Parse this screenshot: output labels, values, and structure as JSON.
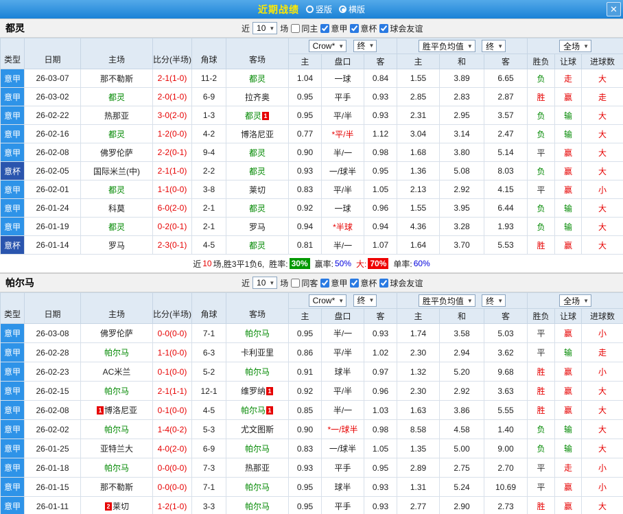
{
  "titlebar": {
    "title": "近期战绩",
    "vertical_label": "竖版",
    "horizontal_label": "横版",
    "close_label": "✕"
  },
  "colors": {
    "league_serie_a": "#2e93e8",
    "league_coppa": "#2a55ae",
    "win_red": "#e60000",
    "lose_green": "#008800",
    "title_yellow": "#ffea00",
    "titlebar_blue": "#1b82d6"
  },
  "table_header": {
    "cols": [
      "类型",
      "日期",
      "主场",
      "比分(半场)",
      "角球",
      "客场"
    ],
    "odds_cols": [
      "主",
      "盘口",
      "客"
    ],
    "avg_cols": [
      "主",
      "和",
      "客"
    ],
    "result_cols": [
      "胜负",
      "让球",
      "进球数"
    ],
    "bookmaker_dd": "Crow*",
    "final_dd": "终",
    "avg_dd": "胜平负均值",
    "scope_dd": "全场"
  },
  "sections": [
    {
      "team": "都灵",
      "filters": {
        "near": "近",
        "count": "10",
        "games": "场",
        "same": "同主",
        "same_checked": false,
        "leagues": [
          "意甲",
          "意杯",
          "球会友谊"
        ],
        "leagues_checked": true
      },
      "rows": [
        {
          "type": "意甲",
          "style": "jia",
          "date": "26-03-07",
          "home": "那不勒斯",
          "home_green": false,
          "score": "2-1(1-0)",
          "corners": "11-2",
          "away": "都灵",
          "away_green": true,
          "odds": [
            "1.04",
            "一球",
            "0.84"
          ],
          "pan_red": false,
          "avg": [
            "1.55",
            "3.89",
            "6.65"
          ],
          "result": "负",
          "result_c": "green",
          "rang": "走",
          "rang_c": "red",
          "goals": "大",
          "goals_c": "red"
        },
        {
          "type": "意甲",
          "style": "jia",
          "date": "26-03-02",
          "home": "都灵",
          "home_green": true,
          "score": "2-0(1-0)",
          "corners": "6-9",
          "away": "拉齐奥",
          "away_green": false,
          "odds": [
            "0.95",
            "平手",
            "0.93"
          ],
          "pan_red": false,
          "avg": [
            "2.85",
            "2.83",
            "2.87"
          ],
          "result": "胜",
          "result_c": "red",
          "rang": "赢",
          "rang_c": "red",
          "goals": "走",
          "goals_c": "red"
        },
        {
          "type": "意甲",
          "style": "jia",
          "date": "26-02-22",
          "home": "热那亚",
          "home_green": false,
          "score": "3-0(2-0)",
          "corners": "1-3",
          "away": "都灵",
          "away_green": true,
          "away_badge_post": "1",
          "odds": [
            "0.95",
            "平/半",
            "0.93"
          ],
          "pan_red": false,
          "avg": [
            "2.31",
            "2.95",
            "3.57"
          ],
          "result": "负",
          "result_c": "green",
          "rang": "输",
          "rang_c": "green",
          "goals": "大",
          "goals_c": "red"
        },
        {
          "type": "意甲",
          "style": "jia",
          "date": "26-02-16",
          "home": "都灵",
          "home_green": true,
          "score": "1-2(0-0)",
          "corners": "4-2",
          "away": "博洛尼亚",
          "away_green": false,
          "odds": [
            "0.77",
            "*平/半",
            "1.12"
          ],
          "pan_red": true,
          "avg": [
            "3.04",
            "3.14",
            "2.47"
          ],
          "result": "负",
          "result_c": "green",
          "rang": "输",
          "rang_c": "green",
          "goals": "大",
          "goals_c": "red"
        },
        {
          "type": "意甲",
          "style": "jia",
          "date": "26-02-08",
          "home": "佛罗伦萨",
          "home_green": false,
          "score": "2-2(0-1)",
          "corners": "9-4",
          "away": "都灵",
          "away_green": true,
          "odds": [
            "0.90",
            "半/一",
            "0.98"
          ],
          "pan_red": false,
          "avg": [
            "1.68",
            "3.80",
            "5.14"
          ],
          "result": "平",
          "result_c": "dark",
          "rang": "赢",
          "rang_c": "red",
          "goals": "大",
          "goals_c": "red"
        },
        {
          "type": "意杯",
          "style": "bei",
          "date": "26-02-05",
          "home": "国际米兰(中)",
          "home_green": false,
          "score": "2-1(1-0)",
          "corners": "2-2",
          "away": "都灵",
          "away_green": true,
          "odds": [
            "0.93",
            "一/球半",
            "0.95"
          ],
          "pan_red": false,
          "avg": [
            "1.36",
            "5.08",
            "8.03"
          ],
          "result": "负",
          "result_c": "green",
          "rang": "赢",
          "rang_c": "red",
          "goals": "大",
          "goals_c": "red"
        },
        {
          "type": "意甲",
          "style": "jia",
          "date": "26-02-01",
          "home": "都灵",
          "home_green": true,
          "score": "1-1(0-0)",
          "corners": "3-8",
          "away": "莱切",
          "away_green": false,
          "odds": [
            "0.83",
            "平/半",
            "1.05"
          ],
          "pan_red": false,
          "avg": [
            "2.13",
            "2.92",
            "4.15"
          ],
          "result": "平",
          "result_c": "dark",
          "rang": "赢",
          "rang_c": "red",
          "goals": "小",
          "goals_c": "red"
        },
        {
          "type": "意甲",
          "style": "jia",
          "date": "26-01-24",
          "home": "科莫",
          "home_green": false,
          "score": "6-0(2-0)",
          "corners": "2-1",
          "away": "都灵",
          "away_green": true,
          "odds": [
            "0.92",
            "一球",
            "0.96"
          ],
          "pan_red": false,
          "avg": [
            "1.55",
            "3.95",
            "6.44"
          ],
          "result": "负",
          "result_c": "green",
          "rang": "输",
          "rang_c": "green",
          "goals": "大",
          "goals_c": "red"
        },
        {
          "type": "意甲",
          "style": "jia",
          "date": "26-01-19",
          "home": "都灵",
          "home_green": true,
          "score": "0-2(0-1)",
          "corners": "2-1",
          "away": "罗马",
          "away_green": false,
          "odds": [
            "0.94",
            "*半球",
            "0.94"
          ],
          "pan_red": true,
          "avg": [
            "4.36",
            "3.28",
            "1.93"
          ],
          "result": "负",
          "result_c": "green",
          "rang": "输",
          "rang_c": "green",
          "goals": "大",
          "goals_c": "red"
        },
        {
          "type": "意杯",
          "style": "bei",
          "date": "26-01-14",
          "home": "罗马",
          "home_green": false,
          "score": "2-3(0-1)",
          "corners": "4-5",
          "away": "都灵",
          "away_green": true,
          "odds": [
            "0.81",
            "半/一",
            "1.07"
          ],
          "pan_red": false,
          "avg": [
            "1.64",
            "3.70",
            "5.53"
          ],
          "result": "胜",
          "result_c": "red",
          "rang": "赢",
          "rang_c": "red",
          "goals": "大",
          "goals_c": "red"
        }
      ],
      "summary": {
        "near": "近",
        "count": "10",
        "rest": "场,胜3平1负6,",
        "win_label": "胜率:",
        "win_pct": "30%",
        "rang_label": "赢率:",
        "rang_pct": "50%",
        "big_label": "大:",
        "big_pct": "70%",
        "single_label": "单率:",
        "single_pct": "60%"
      }
    },
    {
      "team": "帕尔马",
      "filters": {
        "near": "近",
        "count": "10",
        "games": "场",
        "same": "同客",
        "same_checked": false,
        "leagues": [
          "意甲",
          "意杯",
          "球会友谊"
        ],
        "leagues_checked": true
      },
      "rows": [
        {
          "type": "意甲",
          "style": "jia",
          "date": "26-03-08",
          "home": "佛罗伦萨",
          "home_green": false,
          "score": "0-0(0-0)",
          "corners": "7-1",
          "away": "帕尔马",
          "away_green": true,
          "odds": [
            "0.95",
            "半/一",
            "0.93"
          ],
          "pan_red": false,
          "avg": [
            "1.74",
            "3.58",
            "5.03"
          ],
          "result": "平",
          "result_c": "dark",
          "rang": "赢",
          "rang_c": "red",
          "goals": "小",
          "goals_c": "red"
        },
        {
          "type": "意甲",
          "style": "jia",
          "date": "26-02-28",
          "home": "帕尔马",
          "home_green": true,
          "score": "1-1(0-0)",
          "corners": "6-3",
          "away": "卡利亚里",
          "away_green": false,
          "odds": [
            "0.86",
            "平/半",
            "1.02"
          ],
          "pan_red": false,
          "avg": [
            "2.30",
            "2.94",
            "3.62"
          ],
          "result": "平",
          "result_c": "dark",
          "rang": "输",
          "rang_c": "green",
          "goals": "走",
          "goals_c": "red"
        },
        {
          "type": "意甲",
          "style": "jia",
          "date": "26-02-23",
          "home": "AC米兰",
          "home_green": false,
          "score": "0-1(0-0)",
          "corners": "5-2",
          "away": "帕尔马",
          "away_green": true,
          "odds": [
            "0.91",
            "球半",
            "0.97"
          ],
          "pan_red": false,
          "avg": [
            "1.32",
            "5.20",
            "9.68"
          ],
          "result": "胜",
          "result_c": "red",
          "rang": "赢",
          "rang_c": "red",
          "goals": "小",
          "goals_c": "red"
        },
        {
          "type": "意甲",
          "style": "jia",
          "date": "26-02-15",
          "home": "帕尔马",
          "home_green": true,
          "score": "2-1(1-1)",
          "corners": "12-1",
          "away": "维罗纳",
          "away_green": false,
          "away_badge_post": "1",
          "odds": [
            "0.92",
            "平/半",
            "0.96"
          ],
          "pan_red": false,
          "avg": [
            "2.30",
            "2.92",
            "3.63"
          ],
          "result": "胜",
          "result_c": "red",
          "rang": "赢",
          "rang_c": "red",
          "goals": "大",
          "goals_c": "red"
        },
        {
          "type": "意甲",
          "style": "jia",
          "date": "26-02-08",
          "home": "博洛尼亚",
          "home_green": false,
          "home_badge_pre": "1",
          "score": "0-1(0-0)",
          "corners": "4-5",
          "away": "帕尔马",
          "away_green": true,
          "away_badge_post": "1",
          "odds": [
            "0.85",
            "半/一",
            "1.03"
          ],
          "pan_red": false,
          "avg": [
            "1.63",
            "3.86",
            "5.55"
          ],
          "result": "胜",
          "result_c": "red",
          "rang": "赢",
          "rang_c": "red",
          "goals": "大",
          "goals_c": "red"
        },
        {
          "type": "意甲",
          "style": "jia",
          "date": "26-02-02",
          "home": "帕尔马",
          "home_green": true,
          "score": "1-4(0-2)",
          "corners": "5-3",
          "away": "尤文图斯",
          "away_green": false,
          "odds": [
            "0.90",
            "*一/球半",
            "0.98"
          ],
          "pan_red": true,
          "avg": [
            "8.58",
            "4.58",
            "1.40"
          ],
          "result": "负",
          "result_c": "green",
          "rang": "输",
          "rang_c": "green",
          "goals": "大",
          "goals_c": "red"
        },
        {
          "type": "意甲",
          "style": "jia",
          "date": "26-01-25",
          "home": "亚特兰大",
          "home_green": false,
          "score": "4-0(2-0)",
          "corners": "6-9",
          "away": "帕尔马",
          "away_green": true,
          "odds": [
            "0.83",
            "一/球半",
            "1.05"
          ],
          "pan_red": false,
          "avg": [
            "1.35",
            "5.00",
            "9.00"
          ],
          "result": "负",
          "result_c": "green",
          "rang": "输",
          "rang_c": "green",
          "goals": "大",
          "goals_c": "red"
        },
        {
          "type": "意甲",
          "style": "jia",
          "date": "26-01-18",
          "home": "帕尔马",
          "home_green": true,
          "score": "0-0(0-0)",
          "corners": "7-3",
          "away": "热那亚",
          "away_green": false,
          "odds": [
            "0.93",
            "平手",
            "0.95"
          ],
          "pan_red": false,
          "avg": [
            "2.89",
            "2.75",
            "2.70"
          ],
          "result": "平",
          "result_c": "dark",
          "rang": "走",
          "rang_c": "red",
          "goals": "小",
          "goals_c": "red"
        },
        {
          "type": "意甲",
          "style": "jia",
          "date": "26-01-15",
          "home": "那不勒斯",
          "home_green": false,
          "score": "0-0(0-0)",
          "corners": "7-1",
          "away": "帕尔马",
          "away_green": true,
          "odds": [
            "0.95",
            "球半",
            "0.93"
          ],
          "pan_red": false,
          "avg": [
            "1.31",
            "5.24",
            "10.69"
          ],
          "result": "平",
          "result_c": "dark",
          "rang": "赢",
          "rang_c": "red",
          "goals": "小",
          "goals_c": "red"
        },
        {
          "type": "意甲",
          "style": "jia",
          "date": "26-01-11",
          "home": "莱切",
          "home_green": false,
          "home_badge_pre": "2",
          "score": "1-2(1-0)",
          "corners": "3-3",
          "away": "帕尔马",
          "away_green": true,
          "odds": [
            "0.95",
            "平手",
            "0.93"
          ],
          "pan_red": false,
          "avg": [
            "2.77",
            "2.90",
            "2.73"
          ],
          "result": "胜",
          "result_c": "red",
          "rang": "赢",
          "rang_c": "red",
          "goals": "大",
          "goals_c": "red"
        }
      ]
    }
  ]
}
